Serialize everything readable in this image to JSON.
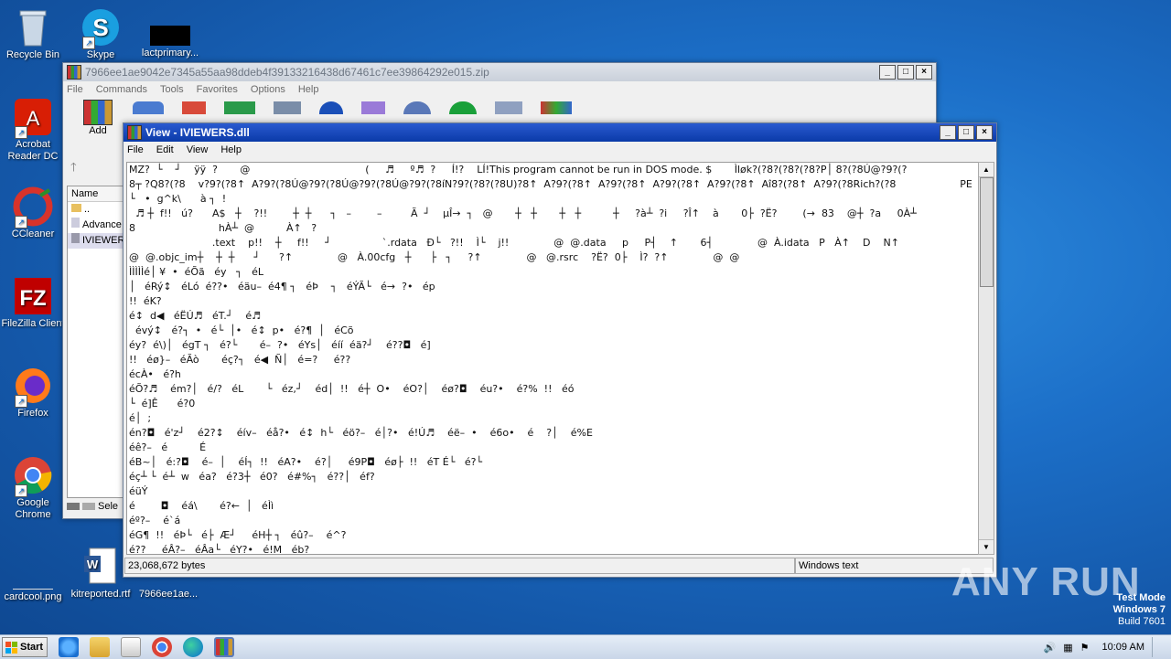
{
  "desktop": {
    "icons": [
      {
        "label": "Recycle Bin"
      },
      {
        "label": "Skype"
      },
      {
        "label": "lactprimary..."
      },
      {
        "label": "Acrobat Reader DC"
      },
      {
        "label": "CCleaner"
      },
      {
        "label": "FileZilla Client"
      },
      {
        "label": "Firefox"
      },
      {
        "label": "Google Chrome"
      },
      {
        "label": "cardcool.png"
      },
      {
        "label": "kitreported.rtf"
      },
      {
        "label": "7966ee1ae..."
      }
    ]
  },
  "archive_window": {
    "title": "7966ee1ae9042e7345a55aa98ddeb4f39133216438d67461c7ee39864292e015.zip",
    "menu": [
      "File",
      "Commands",
      "Tools",
      "Favorites",
      "Options",
      "Help"
    ],
    "toolbar": {
      "add_label": "Add"
    },
    "columns": {
      "name": "Name"
    },
    "files": [
      "..",
      "Advance",
      "IVIEWER"
    ],
    "status": "Sele"
  },
  "viewer_window": {
    "title": "View - IVIEWERS.dll",
    "menu": [
      "File",
      "Edit",
      "View",
      "Help"
    ],
    "lines": [
      "MZ?  └    ┘    ÿÿ  ?       @                                    (     ♬     º♬  ?     Í!?    LÍ!This program cannot be run in DOS mode. $       Ìløk?(?8?(?8?(?8?P│ 8?(?8Ú@?9?(?",
      "8┬ ?Q8?(?8    v?9?(?8↑  A?9?(?8Ú@?9?(?8Ú@?9?(?8Ú@?9?(?8íN?9?(?8?(?8U)?8↑  A?9?(?8↑  A?9?(?8↑  A?9?(?8↑  A?9?(?8↑  Aî8?(?8↑  A?9?(?8Rich?(?8                    PE",
      "└   •  g^k\\      à ┐  !",
      "  ♬ ┼  f!!   ú?      A$   ┼    ?!!        ┼  ┼      ┐   –        –         Ã  ┘    µÎ→  ┐   @       ┼   ┼       ┼   ┼          ┼     ?à┴  ?i     ?Î↑    à       0├  ?Ë?        (→  83    @┼  ?a     0À┴",
      "8                          hÀ┴  @          À↑   ?",
      "                          .text    p!!    ┼     f!!     ┘                `.rdata   Ð└   ?!!    Ì└    j!!              @  @.data     p     P┤    ↑       6┤              @  À.idata   P   À↑    D    N↑",
      "@  @.objc_im┼    ┼  ┼      ┘      ?↑              @   À.00cfg   ┼      ├   ┐     ?↑              @   @.rsrc    ?Ë?  0├    Ì?  ?↑              @  @",
      "ÌÌÌÌÌé│ ¥  •  éÕã   éy   ┐   éL",
      "│   éRý↕   éLó  é??•   éäu–  é4¶ ┐   éÞ    ┐   éÝÃ└   é→  ?•   ép",
      "!!  éK?",
      "é↕  d◀   éËÚ♬   éT.┘    é♬",
      "  évý↕   é?┐  •   é└  │•   é↕  p•   é?¶  │   éCõ",
      "éy?  é\\)│   égT ┐   é?└       é–  ?•   éYs│   éíí  éä?┘    é??◘   é]",
      "!!   éø}–   éÃò       éç?┐   é◀  Ñ│   é=?     é??",
      "écÀ•   é?h",
      "éÕ?♬    ém?│   é/?   éL       └   éz,┘    éd│  !!   é┼  O•    éO?│    éø?◘    éu?•    é?%  !!   éó",
      "└  é]Ê      é?0",
      "é│  ;",
      "én?◘   é'z┘    é2?↕    éív–   éå?•   é↕  h└   éö?–   é│?•   é!Ú♬    éë–  •    é6o•    é    ?│    é%E",
      "éê?–   é          É",
      "éB~│   é:?◘    é–  │    éÍ┐  !!   éA?•    é?│     é9P◘   éø├  !!   éT É└   é?└",
      "éç┴ └  é┴  w   éa?   é?3┼   é0?   é#%┐   é??│   éf?",
      "éüÝ",
      "é        ◘    éá\\       é?←  │   éÌì",
      "éº?–    é`á",
      "éG¶  !!   éÞ└   é├  Æ┘     éH┼ ┐   éû?–    é^?",
      "é??     éÂ?–   éÂa└   éY?•   é!M   éb?"
    ],
    "status_size": "23,068,672 bytes",
    "status_encoding": "Windows text"
  },
  "watermark": "ANY RUN",
  "test_mode": {
    "line1": "Test Mode",
    "line2": "Windows 7",
    "line3": "Build 7601"
  },
  "taskbar": {
    "start_label": "Start",
    "clock": "10:09 AM"
  }
}
